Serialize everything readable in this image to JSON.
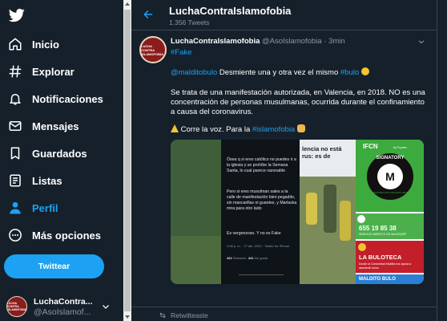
{
  "sidebar": {
    "logo": "twitter-bird-icon",
    "items": [
      {
        "label": "Inicio",
        "icon": "home-icon"
      },
      {
        "label": "Explorar",
        "icon": "hashtag-icon"
      },
      {
        "label": "Notificaciones",
        "icon": "bell-icon"
      },
      {
        "label": "Mensajes",
        "icon": "envelope-icon"
      },
      {
        "label": "Guardados",
        "icon": "bookmark-icon"
      },
      {
        "label": "Listas",
        "icon": "list-icon"
      },
      {
        "label": "Perfil",
        "icon": "person-icon",
        "active": true
      },
      {
        "label": "Más opciones",
        "icon": "more-circle-icon"
      }
    ],
    "tweet_button": "Twittear",
    "account": {
      "name": "LuchaContra...",
      "handle": "@AsoIslamof...",
      "avatar_text": "LUCHA CONTRA ISLAMOFOBIA"
    }
  },
  "header": {
    "title": "LuchaContraIslamofobia",
    "subtitle": "1.356 Tweets"
  },
  "tweet": {
    "name": "LuchaContraIslamofobia",
    "handle": "@AsoIslamofobia",
    "dot": "·",
    "time": "3min",
    "hashtag_top": "#Fake",
    "line1_mention": "@malditobulo",
    "line1_text": " Desmiente una y otra vez el mismo ",
    "line1_tag": "#bulo",
    "para1": [
      "Se trata de una manifestación autorizada, en Valencia, en 2018. NO es una",
      "concentración de personas musulmanas, ocurrida durante el confinamiento",
      "a causa del coronavirus."
    ],
    "line_last_text": "Corre la voz. Para la ",
    "line_last_tag": "#islamofobia",
    "media": {
      "phone_text_1": "Ósea q si eres católico no puedes ir a la iglesia y se prohíbe la Semana Santa, lo cual parece razonable",
      "phone_text_2": "Pero si eres musulman sales a la calle de manifestación bien pegadito, sin mascarillas ni guantes, y Marlaska mira para otro lado",
      "phone_text_3": "Es vergonzoso. Y no es Fake",
      "phone_meta": "4:56 p. m. · 27 abr. 2020 · Twitter for iPhone",
      "phone_rt_count": "262",
      "phone_rt_label": "Retweets",
      "phone_like_count": "441",
      "phone_like_label": "Me gusta",
      "news_headline": "lencia no está\nrus: es de",
      "ifcn_title": "IFCN",
      "ifcn_by": "by Poynter",
      "badge_top": "SIGNATORY",
      "badge_letter": "M",
      "badge_bottom": "INTERNATIONAL FACT-CHECKING NETWORK",
      "phone_number": "655 19 85 38",
      "phone_sub": "SERVICIO DIRECTO DE WHATSAPP",
      "lab_title": "LA BULOTECA",
      "lab_sub": "Donde la Comunidad Maldita nos ayuda a desmentir bulos",
      "next_text": "MALDITO BULO"
    },
    "retweet_label": "Retwitteaste"
  },
  "colors": {
    "background": "#15202b",
    "accent": "#1da1f2",
    "muted": "#8899a6",
    "border": "#38444d"
  }
}
